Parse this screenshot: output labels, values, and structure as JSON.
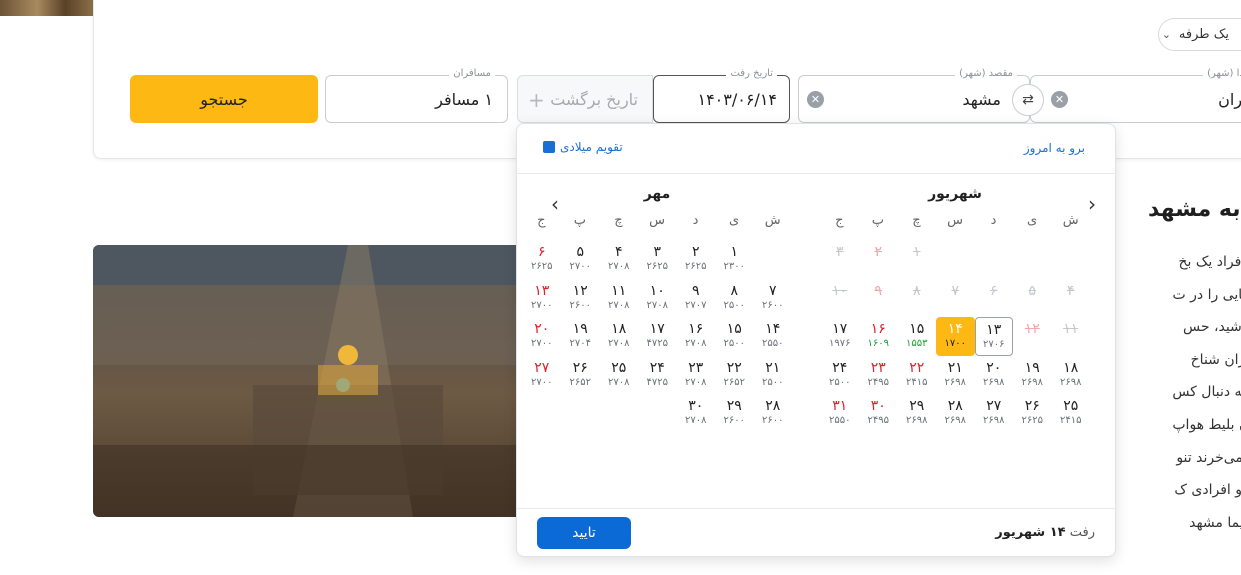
{
  "search": {
    "trip_type": "یک طرفه",
    "origin_label": "مبدا (شهر)",
    "origin_value": "تهران",
    "destination_label": "مقصد (شهر)",
    "destination_value": "مشهد",
    "depart_label": "تاریخ رفت",
    "depart_value": "۱۴۰۳/۰۶/۱۴",
    "return_placeholder": "تاریخ برگشت",
    "passengers_label": "مسافران",
    "passengers_value": "۱ مسافر",
    "search_button": "جستجو"
  },
  "article": {
    "title": "به مشهد",
    "lines": [
      "ی همه افراد یک بخ",
      "ساعت‌هایی را در ت",
      "داشته باشید، حس",
      "ذهبی ایران شناخ",
      "شده و به دنبال کس",
      "مین الان بلیط هواپ",
      "شهد را می‌خرند تنو",
      "شده‌اند و افرادی ک",
      "یط هواپیما مشهد"
    ]
  },
  "calendar": {
    "goto_today": "برو به امروز",
    "gregorian_toggle": "تقویم میلادی",
    "confirm_button": "تایید",
    "summary_prefix": "رفت",
    "summary_value": "۱۴ شهریور",
    "weekdays": [
      "ش",
      "ی",
      "د",
      "س",
      "چ",
      "پ",
      "ج"
    ],
    "months": [
      {
        "name": "شهریور",
        "offset": 4,
        "days": [
          {
            "n": "۱",
            "past": true
          },
          {
            "n": "۲",
            "past": true,
            "fri": true
          },
          {
            "n": "۳",
            "past": true
          },
          {
            "n": "۴",
            "past": true
          },
          {
            "n": "۵",
            "past": true
          },
          {
            "n": "۶",
            "past": true
          },
          {
            "n": "۷",
            "past": true
          },
          {
            "n": "۸",
            "past": true
          },
          {
            "n": "۹",
            "past": true,
            "fri": true
          },
          {
            "n": "۱۰",
            "past": true
          },
          {
            "n": "۱۱",
            "past": true
          },
          {
            "n": "۱۲",
            "past": true,
            "fri": true
          },
          {
            "n": "۱۳",
            "p": "۲۷۰۶",
            "today": true
          },
          {
            "n": "۱۴",
            "p": "۱۷۰۰",
            "selected": true
          },
          {
            "n": "۱۵",
            "p": "۱۵۵۳",
            "green": true
          },
          {
            "n": "۱۶",
            "p": "۱۶۰۹",
            "fri": true,
            "green": true
          },
          {
            "n": "۱۷",
            "p": "۱۹۷۶"
          },
          {
            "n": "۱۸",
            "p": "۲۶۹۸"
          },
          {
            "n": "۱۹",
            "p": "۲۶۹۸"
          },
          {
            "n": "۲۰",
            "p": "۲۶۹۸"
          },
          {
            "n": "۲۱",
            "p": "۲۶۹۸"
          },
          {
            "n": "۲۲",
            "p": "۲۴۱۵",
            "fri": true
          },
          {
            "n": "۲۳",
            "p": "۲۴۹۵",
            "fri": true
          },
          {
            "n": "۲۴",
            "p": "۲۵۰۰"
          },
          {
            "n": "۲۵",
            "p": "۲۴۱۵"
          },
          {
            "n": "۲۶",
            "p": "۲۶۲۵"
          },
          {
            "n": "۲۷",
            "p": "۲۶۹۸"
          },
          {
            "n": "۲۸",
            "p": "۲۶۹۸"
          },
          {
            "n": "۲۹",
            "p": "۲۶۹۸"
          },
          {
            "n": "۳۰",
            "p": "۲۴۹۵",
            "fri": true
          },
          {
            "n": "۳۱",
            "p": "۲۵۵۰",
            "fri": true
          }
        ]
      },
      {
        "name": "مهر",
        "offset": 1,
        "days": [
          {
            "n": "۱",
            "p": "۲۳۰۰"
          },
          {
            "n": "۲",
            "p": "۲۶۲۵"
          },
          {
            "n": "۳",
            "p": "۲۶۲۵"
          },
          {
            "n": "۴",
            "p": "۲۷۰۸"
          },
          {
            "n": "۵",
            "p": "۲۷۰۰"
          },
          {
            "n": "۶",
            "p": "۲۶۲۵",
            "fri": true
          },
          {
            "n": "۷",
            "p": "۲۶۰۰"
          },
          {
            "n": "۸",
            "p": "۲۵۰۰"
          },
          {
            "n": "۹",
            "p": "۲۷۰۷"
          },
          {
            "n": "۱۰",
            "p": "۲۷۰۸"
          },
          {
            "n": "۱۱",
            "p": "۲۷۰۸"
          },
          {
            "n": "۱۲",
            "p": "۲۶۰۰"
          },
          {
            "n": "۱۳",
            "p": "۲۷۰۰",
            "fri": true
          },
          {
            "n": "۱۴",
            "p": "۲۵۵۰"
          },
          {
            "n": "۱۵",
            "p": "۲۵۰۰"
          },
          {
            "n": "۱۶",
            "p": "۲۷۰۸"
          },
          {
            "n": "۱۷",
            "p": "۴۷۲۵"
          },
          {
            "n": "۱۸",
            "p": "۲۷۰۸"
          },
          {
            "n": "۱۹",
            "p": "۲۷۰۴"
          },
          {
            "n": "۲۰",
            "p": "۲۷۰۰",
            "fri": true
          },
          {
            "n": "۲۱",
            "p": "۲۵۰۰"
          },
          {
            "n": "۲۲",
            "p": "۲۶۵۲"
          },
          {
            "n": "۲۳",
            "p": "۲۷۰۸"
          },
          {
            "n": "۲۴",
            "p": "۴۷۲۵"
          },
          {
            "n": "۲۵",
            "p": "۲۷۰۸"
          },
          {
            "n": "۲۶",
            "p": "۲۶۵۲"
          },
          {
            "n": "۲۷",
            "p": "۲۷۰۰",
            "fri": true
          },
          {
            "n": "۲۸",
            "p": "۲۶۰۰"
          },
          {
            "n": "۲۹",
            "p": "۲۶۰۰"
          },
          {
            "n": "۳۰",
            "p": "۲۷۰۸"
          }
        ]
      }
    ]
  }
}
